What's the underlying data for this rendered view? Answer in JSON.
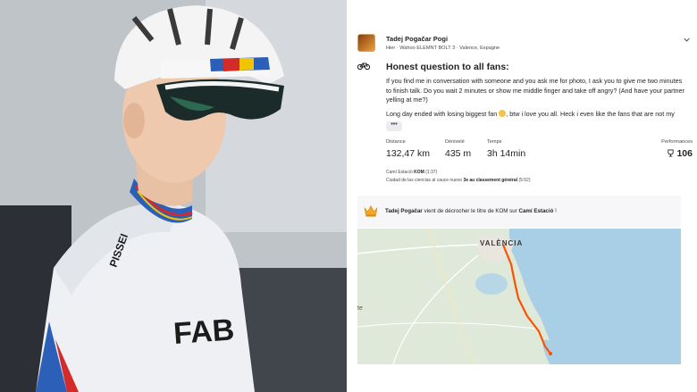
{
  "post": {
    "athlete_name": "Tadej Pogačar Pogi",
    "meta": "Hier · Wahoo ELEMNT BOLT 3 · Valence, Espagne",
    "title": "Honest question to all fans:",
    "description": "If you find me in conversation with someone and you ask me for photo, I ask you to give me two minutes to finish talk. Do you wait 2 minutes or show me middle finger and take off angry? (And have your partner yelling at me?)",
    "description2_a": "Long day ended with losing biggest fan",
    "description2_b": ", btw i love you all. Heck i even like the fans that are not my",
    "more_label": "•••",
    "icons": {
      "avatar": "athlete-avatar",
      "menu": "chevron-down-icon",
      "activity": "bike-icon",
      "performance": "trophy-icon",
      "kom": "crown-icon"
    }
  },
  "stats": [
    {
      "label": "Distance",
      "value": "132,47 km"
    },
    {
      "label": "Dénivelé",
      "value": "435 m"
    },
    {
      "label": "Temps",
      "value": "3h 14min"
    }
  ],
  "performance": {
    "label": "Performances",
    "value": "106"
  },
  "segments": [
    {
      "name": "Camí Estació",
      "badge": "KOM",
      "time": "(1:37)",
      "rank": "",
      "rank_suffix": ""
    },
    {
      "name": "Ciudad de las ciencias al cauce nuevo",
      "badge": "",
      "time": "(5:52)",
      "rank": "3e au classement général",
      "rank_suffix": ""
    }
  ],
  "kom_notice": {
    "athlete": "Tadej Pogačar",
    "text": " vient de décrocher le titre de KOM sur ",
    "segment": "Camí Estació",
    "end": " !"
  },
  "map": {
    "city_label": "VALÈNCIA",
    "edge_label": "te",
    "route_color": "#fc5200",
    "sea_color": "#a9cfe6",
    "land_color": "#dfe9d9"
  },
  "colors": {
    "accent": "#fc5200",
    "text": "#242428"
  }
}
